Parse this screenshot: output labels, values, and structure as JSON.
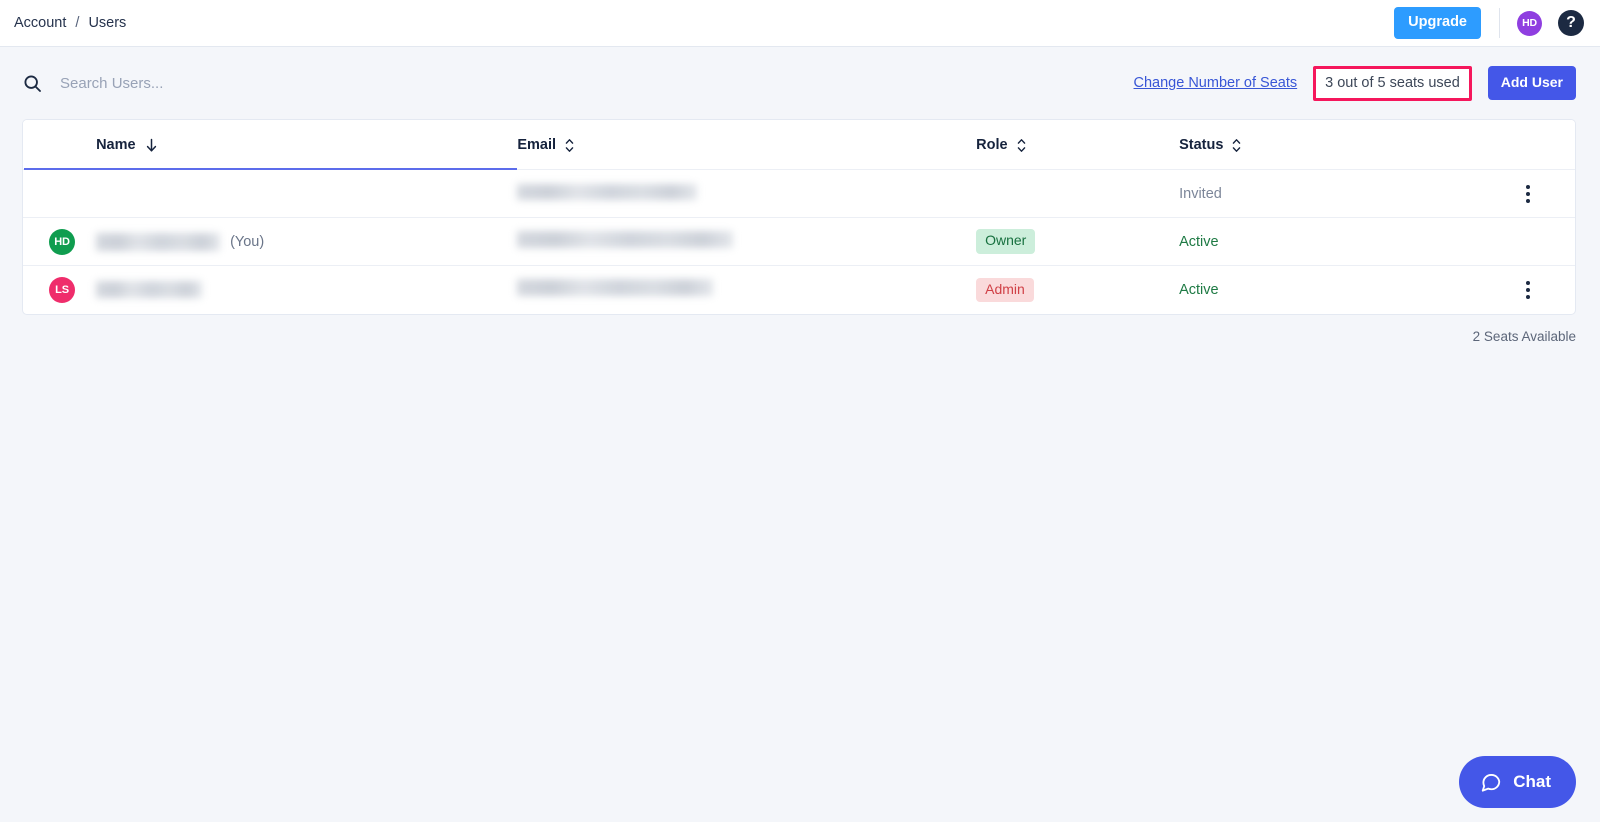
{
  "topbar": {
    "breadcrumb": [
      "Account",
      "Users"
    ],
    "separator": "/",
    "upgrade_label": "Upgrade",
    "avatar_initials": "HD",
    "avatar_color": "#8f3ee0",
    "help_glyph": "?"
  },
  "toolbar": {
    "search_placeholder": "Search Users...",
    "search_value": "",
    "change_seats_link": "Change Number of Seats",
    "seats_used": "3 out of 5 seats used",
    "seats_used_highlight_color": "#f5175c",
    "add_user_label": "Add User"
  },
  "table": {
    "columns": [
      {
        "key": "name",
        "label": "Name",
        "sort": "desc"
      },
      {
        "key": "email",
        "label": "Email",
        "sort": "none"
      },
      {
        "key": "role",
        "label": "Role",
        "sort": "none"
      },
      {
        "key": "status",
        "label": "Status",
        "sort": "none"
      }
    ],
    "rows": [
      {
        "avatar_initials": "",
        "avatar_color": "",
        "name": "",
        "name_redacted": true,
        "you_label": "",
        "email": "",
        "email_redacted": true,
        "role": "",
        "status": "Invited",
        "status_kind": "invited",
        "has_menu": true
      },
      {
        "avatar_initials": "HD",
        "avatar_color": "#0f9d4f",
        "name": "",
        "name_redacted": true,
        "you_label": "(You)",
        "email": "",
        "email_redacted": true,
        "role": "Owner",
        "role_kind": "owner",
        "status": "Active",
        "status_kind": "active",
        "has_menu": false
      },
      {
        "avatar_initials": "LS",
        "avatar_color": "#ef2d6b",
        "name": "",
        "name_redacted": true,
        "you_label": "",
        "email": "",
        "email_redacted": true,
        "role": "Admin",
        "role_kind": "admin",
        "status": "Active",
        "status_kind": "active",
        "has_menu": true
      }
    ],
    "footer_note": "2 Seats Available"
  },
  "chat": {
    "label": "Chat",
    "color": "#4457e8"
  }
}
